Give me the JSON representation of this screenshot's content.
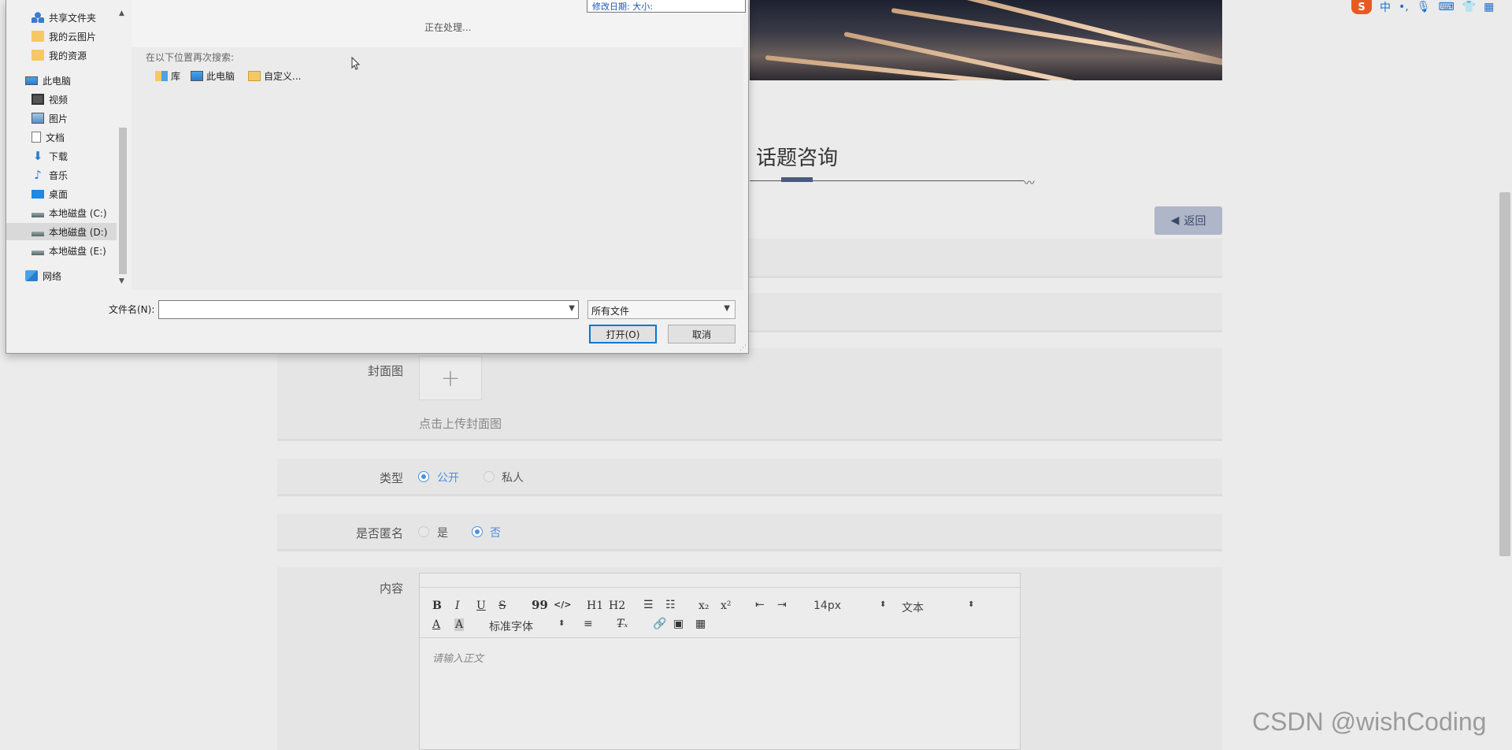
{
  "dialog": {
    "nav_items": [
      {
        "label": "共享文件夹",
        "icon": "shared-folder-icon"
      },
      {
        "label": "我的云图片",
        "icon": "folder-icon"
      },
      {
        "label": "我的资源",
        "icon": "folder-icon"
      },
      {
        "label": "此电脑",
        "icon": "computer-icon"
      },
      {
        "label": "视频",
        "icon": "video-icon"
      },
      {
        "label": "图片",
        "icon": "picture-icon"
      },
      {
        "label": "文档",
        "icon": "document-icon"
      },
      {
        "label": "下载",
        "icon": "download-icon"
      },
      {
        "label": "音乐",
        "icon": "music-icon"
      },
      {
        "label": "桌面",
        "icon": "desktop-icon"
      },
      {
        "label": "本地磁盘 (C:)",
        "icon": "drive-icon"
      },
      {
        "label": "本地磁盘 (D:)",
        "icon": "drive-icon"
      },
      {
        "label": "本地磁盘 (E:)",
        "icon": "drive-icon"
      },
      {
        "label": "网络",
        "icon": "network-icon"
      }
    ],
    "tooltip": "修改日期:    大小:",
    "processing": "正在处理...",
    "search_again": "在以下位置再次搜索:",
    "search_locations": [
      {
        "label": "库",
        "icon": "library-icon"
      },
      {
        "label": "此电脑",
        "icon": "computer-icon"
      },
      {
        "label": "自定义...",
        "icon": "custom-folder-icon"
      }
    ],
    "filename_label": "文件名(N):",
    "filename_value": "",
    "filetype_value": "所有文件",
    "open_label": "打开(O)",
    "cancel_label": "取消"
  },
  "page": {
    "section_title": "话题咨询",
    "back_label": "返回",
    "cover_label": "封面图",
    "cover_hint": "点击上传封面图",
    "type_label": "类型",
    "type_options": [
      "公开",
      "私人"
    ],
    "type_selected": "公开",
    "anon_label": "是否匿名",
    "anon_options": [
      "是",
      "否"
    ],
    "anon_selected": "否",
    "content_label": "内容",
    "editor": {
      "font_size": "14px",
      "text_style": "文本",
      "font_family": "标准字体",
      "placeholder": "请输入正文",
      "buttons": [
        "B",
        "I",
        "U",
        "S",
        "99",
        "</>",
        "H1",
        "H2",
        "ordered-list",
        "bullet-list",
        "x₂",
        "x²",
        "outdent",
        "indent"
      ]
    }
  },
  "tray": {
    "items": [
      "S",
      "中",
      "•,",
      "mic",
      "keyboard",
      "shirt",
      "grid"
    ]
  },
  "watermark": "CSDN @wishCoding",
  "colors": {
    "accent": "#4a90e2",
    "back_button": "#aeb6c8",
    "section_mark": "#4a5a80",
    "dialog_focus": "#0078d7"
  }
}
